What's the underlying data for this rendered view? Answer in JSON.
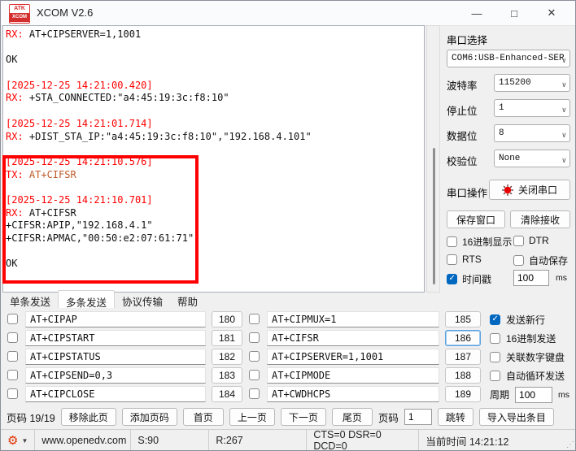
{
  "window": {
    "title": "XCOM V2.6",
    "logo_top": "ATK",
    "logo_bottom": "XCOM",
    "minimize": "—",
    "maximize": "□",
    "close": "✕"
  },
  "terminal": {
    "lines": [
      {
        "meta": "RX: ",
        "body": "AT+CIPSERVER=1,1001"
      },
      {},
      {
        "body": "OK"
      },
      {},
      {
        "meta": "[2025-12-25 14:21:00.420]"
      },
      {
        "meta": "RX: ",
        "body": "+STA_CONNECTED:\"a4:45:19:3c:f8:10\""
      },
      {},
      {
        "meta": "[2025-12-25 14:21:01.714]"
      },
      {
        "meta": "RX: ",
        "body": "+DIST_STA_IP:\"a4:45:19:3c:f8:10\",\"192.168.4.101\""
      },
      {},
      {
        "meta": "[2025-12-25 14:21:10.576]"
      },
      {
        "meta": "TX: ",
        "body": "AT+CIFSR",
        "tx": true
      },
      {},
      {
        "meta": "[2025-12-25 14:21:10.701]"
      },
      {
        "meta": "RX: ",
        "body": "AT+CIFSR"
      },
      {
        "body": "+CIFSR:APIP,\"192.168.4.1\""
      },
      {
        "body": "+CIFSR:APMAC,\"00:50:e2:07:61:71\""
      },
      {},
      {
        "body": "OK"
      }
    ]
  },
  "serial_panel": {
    "port_label": "串口选择",
    "port_value": "COM6:USB-Enhanced-SER",
    "settings": [
      {
        "label": "波特率",
        "value": "115200"
      },
      {
        "label": "停止位",
        "value": "1"
      },
      {
        "label": "数据位",
        "value": "8"
      },
      {
        "label": "校验位",
        "value": "None"
      }
    ],
    "operation_label": "串口操作",
    "close_button": "关闭串口",
    "save_window": "保存窗口",
    "clear_receive": "清除接收",
    "checkboxes": [
      {
        "label": "16进制显示",
        "checked": false
      },
      {
        "label": "DTR",
        "checked": false
      },
      {
        "label": "RTS",
        "checked": false
      },
      {
        "label": "自动保存",
        "checked": false
      }
    ],
    "timestamp": {
      "label": "时间戳",
      "checked": true,
      "value": "100",
      "unit": "ms"
    }
  },
  "tabs": [
    {
      "label": "单条发送",
      "active": false
    },
    {
      "label": "多条发送",
      "active": true
    },
    {
      "label": "协议传输",
      "active": false
    },
    {
      "label": "帮助",
      "active": false
    }
  ],
  "multi_send": {
    "rows_left": [
      {
        "cmd": "AT+CIPAP",
        "num": "180",
        "checked": false,
        "focused": false
      },
      {
        "cmd": "AT+CIPSTART",
        "num": "181",
        "checked": false,
        "focused": false
      },
      {
        "cmd": "AT+CIPSTATUS",
        "num": "182",
        "checked": false,
        "focused": false
      },
      {
        "cmd": "AT+CIPSEND=0,3",
        "num": "183",
        "checked": false,
        "focused": false
      },
      {
        "cmd": "AT+CIPCLOSE",
        "num": "184",
        "checked": false,
        "focused": false
      }
    ],
    "rows_right": [
      {
        "cmd": "AT+CIPMUX=1",
        "num": "185",
        "checked": false,
        "focused": false
      },
      {
        "cmd": "AT+CIFSR",
        "num": "186",
        "checked": false,
        "focused": true
      },
      {
        "cmd": "AT+CIPSERVER=1,1001",
        "num": "187",
        "checked": false,
        "focused": false
      },
      {
        "cmd": "AT+CIPMODE",
        "num": "188",
        "checked": false,
        "focused": false
      },
      {
        "cmd": "AT+CWDHCPS",
        "num": "189",
        "checked": false,
        "focused": false
      }
    ],
    "options": [
      {
        "label": "发送新行",
        "checked": true
      },
      {
        "label": "16进制发送",
        "checked": false
      },
      {
        "label": "关联数字键盘",
        "checked": false
      },
      {
        "label": "自动循环发送",
        "checked": false
      }
    ],
    "period": {
      "label": "周期",
      "value": "100",
      "unit": "ms"
    }
  },
  "pagination": {
    "page_label": "页码 19/19",
    "buttons": [
      "移除此页",
      "添加页码",
      "首页",
      "上一页",
      "下一页",
      "尾页"
    ],
    "goto_label": "页码",
    "goto_value": "1",
    "jump": "跳转",
    "import_export": "导入导出条目"
  },
  "status_bar": {
    "site": "www.openedv.com",
    "sent": "S:90",
    "received": "R:267",
    "signals": "CTS=0 DSR=0 DCD=0",
    "time": "当前时间 14:21:12"
  },
  "colors": {
    "accent": "#0067c0",
    "log_red": "#ff0000",
    "tx_text": "#bf5b28",
    "highlight_box": "#ff0000"
  }
}
